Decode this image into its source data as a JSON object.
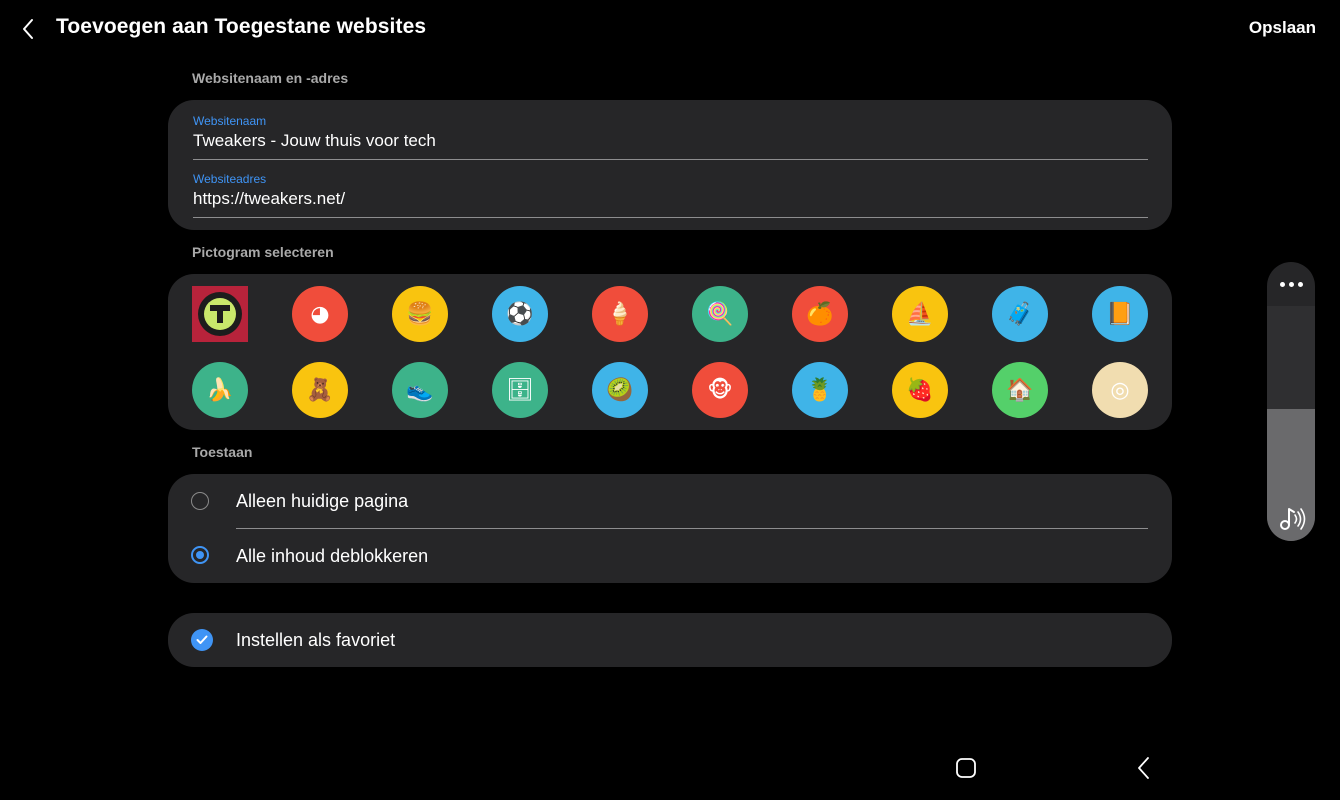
{
  "header": {
    "title": "Toevoegen aan Toegestane websites",
    "save_label": "Opslaan",
    "back_icon": "chevron-left-icon"
  },
  "website_section": {
    "label": "Websitenaam en -adres",
    "name_field": {
      "label": "Websitenaam",
      "value": "Tweakers - Jouw thuis voor tech"
    },
    "address_field": {
      "label": "Websiteadres",
      "value": "https://tweakers.net/"
    }
  },
  "icon_section": {
    "label": "Pictogram selecteren",
    "icons": [
      {
        "name": "tweakers-logo-icon",
        "glyph": "T",
        "color": "#b8233b",
        "selected": true
      },
      {
        "name": "beach-ball-icon",
        "glyph": "◕",
        "color": "#f04d3b"
      },
      {
        "name": "burger-icon",
        "glyph": "🍔",
        "color": "#f9c40f"
      },
      {
        "name": "soccer-ball-icon",
        "glyph": "⚽",
        "color": "#3fb4e8"
      },
      {
        "name": "ice-cream-icon",
        "glyph": "🍦",
        "color": "#f04d3b"
      },
      {
        "name": "lollipop-icon",
        "glyph": "🍭",
        "color": "#3db38a"
      },
      {
        "name": "orange-icon",
        "glyph": "🍊",
        "color": "#f04d3b"
      },
      {
        "name": "sailboat-icon",
        "glyph": "⛵",
        "color": "#f9c40f"
      },
      {
        "name": "suitcase-icon",
        "glyph": "🧳",
        "color": "#3fb4e8"
      },
      {
        "name": "book-icon",
        "glyph": "📙",
        "color": "#3fb4e8"
      },
      {
        "name": "banana-icon",
        "glyph": "🍌",
        "color": "#3db38a"
      },
      {
        "name": "toy-box-icon",
        "glyph": "🧸",
        "color": "#f9c40f"
      },
      {
        "name": "sneaker-icon",
        "glyph": "👟",
        "color": "#3db38a"
      },
      {
        "name": "dresser-icon",
        "glyph": "🗄",
        "color": "#3db38a"
      },
      {
        "name": "kiwi-icon",
        "glyph": "🥝",
        "color": "#3fb4e8"
      },
      {
        "name": "monkey-icon",
        "glyph": "🐵",
        "color": "#f04d3b"
      },
      {
        "name": "pineapple-icon",
        "glyph": "🍍",
        "color": "#3fb4e8"
      },
      {
        "name": "strawberry-icon",
        "glyph": "🍓",
        "color": "#f9c40f"
      },
      {
        "name": "house-icon",
        "glyph": "🏠",
        "color": "#54d06a"
      },
      {
        "name": "lemon-slice-icon",
        "glyph": "◎",
        "color": "#f1ddb0"
      }
    ]
  },
  "allow_section": {
    "label": "Toestaan",
    "options": [
      {
        "label": "Alleen huidige pagina",
        "checked": false
      },
      {
        "label": "Alle inhoud deblokkeren",
        "checked": true
      }
    ]
  },
  "favorite": {
    "label": "Instellen als favoriet",
    "checked": true
  },
  "volume": {
    "level": 0.56,
    "icon": "music-note-volume-icon",
    "more_icon": "more-options-icon"
  },
  "navbar": {
    "home_icon": "home-icon",
    "back_icon": "back-icon"
  }
}
